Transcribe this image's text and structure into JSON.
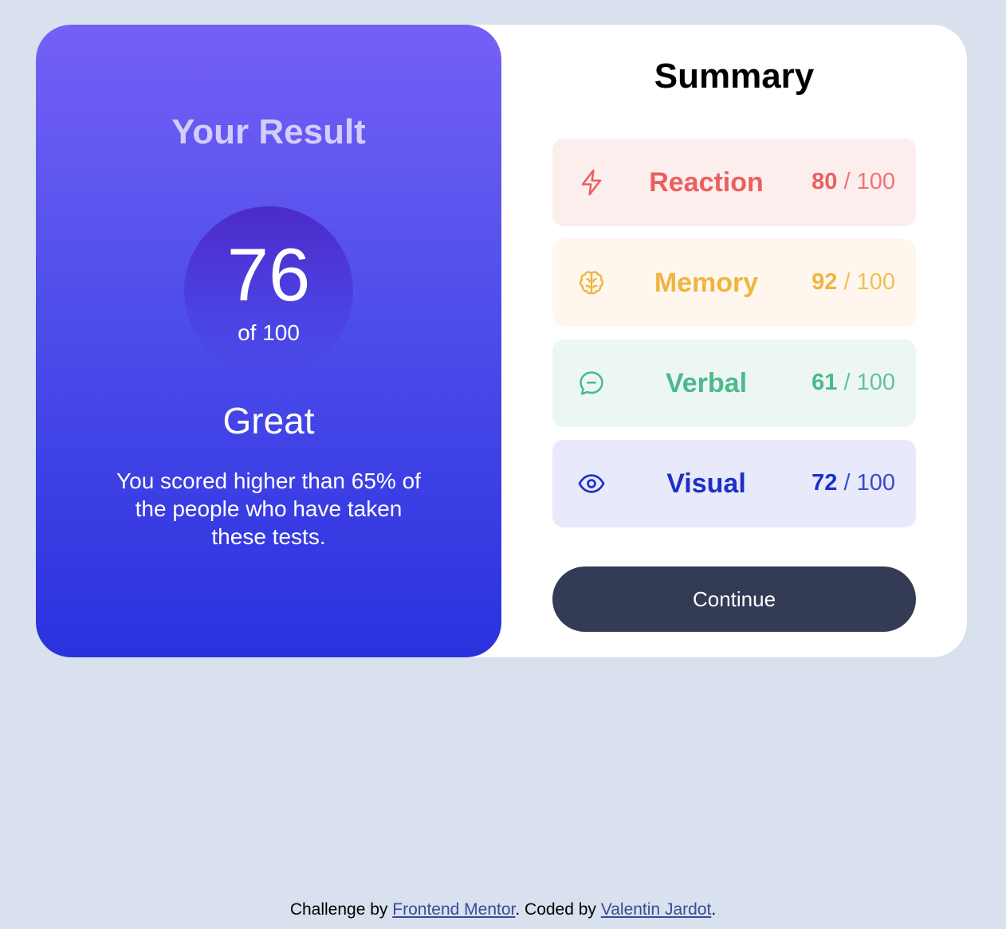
{
  "result": {
    "title": "Your Result",
    "score": "76",
    "total": "of 100",
    "verdict": "Great",
    "description": "You scored higher than 65% of the people who have taken these tests."
  },
  "summary": {
    "title": "Summary",
    "items": [
      {
        "label": "Reaction",
        "score": "80",
        "max": "/ 100",
        "icon": "lightning-icon",
        "color": "#e9605e",
        "bg": "#fdeeee"
      },
      {
        "label": "Memory",
        "score": "92",
        "max": "/ 100",
        "icon": "brain-icon",
        "color": "#f0b440",
        "bg": "#fff7ed"
      },
      {
        "label": "Verbal",
        "score": "61",
        "max": "/ 100",
        "icon": "chat-bubble-icon",
        "color": "#4cb98c",
        "bg": "#ecf7f3"
      },
      {
        "label": "Visual",
        "score": "72",
        "max": "/ 100",
        "icon": "eye-icon",
        "color": "#1d2fc6",
        "bg": "#e8e9fb"
      }
    ],
    "continue_label": "Continue"
  },
  "footer": {
    "prefix": "Challenge by",
    "link1": "Frontend Mentor",
    "middle": ". Coded by",
    "link2": "Valentin Jardot",
    "suffix": "."
  }
}
